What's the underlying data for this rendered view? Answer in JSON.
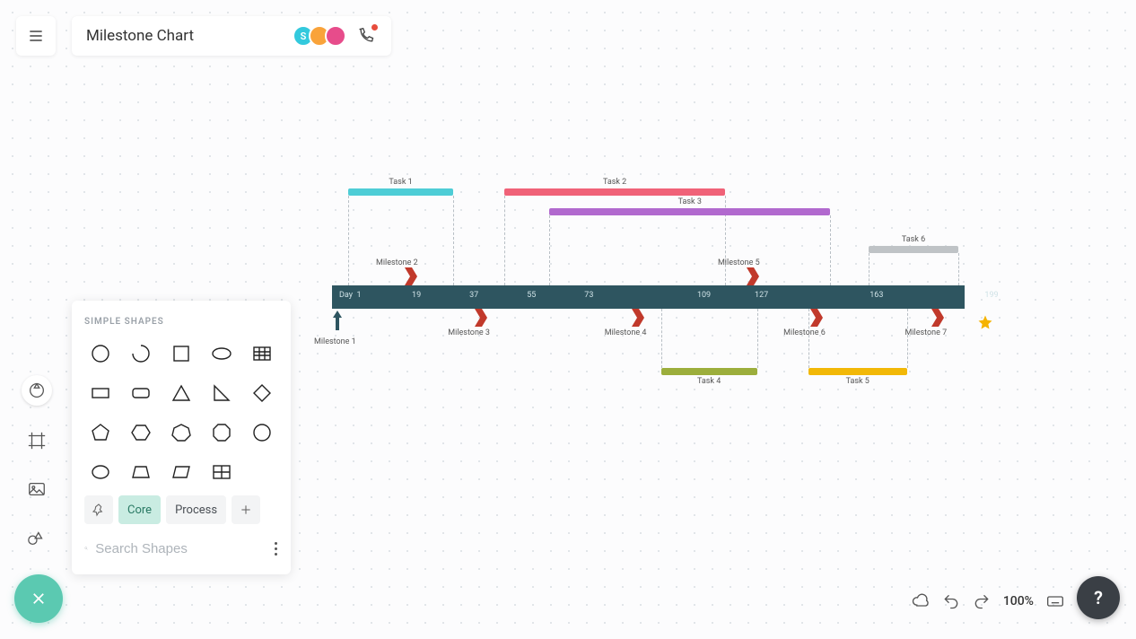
{
  "header": {
    "title": "Milestone Chart",
    "avatars": [
      "S",
      "",
      ""
    ]
  },
  "shapes_panel": {
    "heading": "SIMPLE SHAPES",
    "tabs": {
      "core": "Core",
      "process": "Process"
    },
    "search_placeholder": "Search Shapes"
  },
  "footer": {
    "zoom": "100%",
    "help": "?"
  },
  "chart_data": {
    "type": "bar",
    "title": "Milestone Chart",
    "xlabel": "Day",
    "ylabel": "",
    "ylim": [
      1,
      199
    ],
    "axis_label": "Day",
    "ticks": [
      1,
      19,
      37,
      55,
      73,
      109,
      127,
      163,
      199
    ],
    "tasks": [
      {
        "name": "Task 1",
        "start": 6,
        "end": 39,
        "row": 0,
        "color": "#4ecdd6"
      },
      {
        "name": "Task 2",
        "start": 55,
        "end": 124,
        "row": 0,
        "color": "#f06278"
      },
      {
        "name": "Task 3",
        "start": 69,
        "end": 157,
        "row": 1,
        "color": "#b169ce"
      },
      {
        "name": "Task 4",
        "start": 104,
        "end": 134,
        "row": -1,
        "color": "#9cae3c"
      },
      {
        "name": "Task 5",
        "start": 150,
        "end": 181,
        "row": -1,
        "color": "#f2b807"
      },
      {
        "name": "Task 6",
        "start": 169,
        "end": 197,
        "row": 2,
        "color": "#bfc3c6"
      }
    ],
    "milestones": [
      {
        "name": "Milestone 1",
        "day": 1,
        "side": "below",
        "style": "arrow"
      },
      {
        "name": "Milestone 2",
        "day": 17,
        "side": "above"
      },
      {
        "name": "Milestone 3",
        "day": 39,
        "side": "below"
      },
      {
        "name": "Milestone 4",
        "day": 88,
        "side": "below"
      },
      {
        "name": "Milestone 5",
        "day": 124,
        "side": "above"
      },
      {
        "name": "Milestone 6",
        "day": 144,
        "side": "below"
      },
      {
        "name": "Milestone 7",
        "day": 182,
        "side": "below"
      }
    ],
    "star_day": 197
  }
}
